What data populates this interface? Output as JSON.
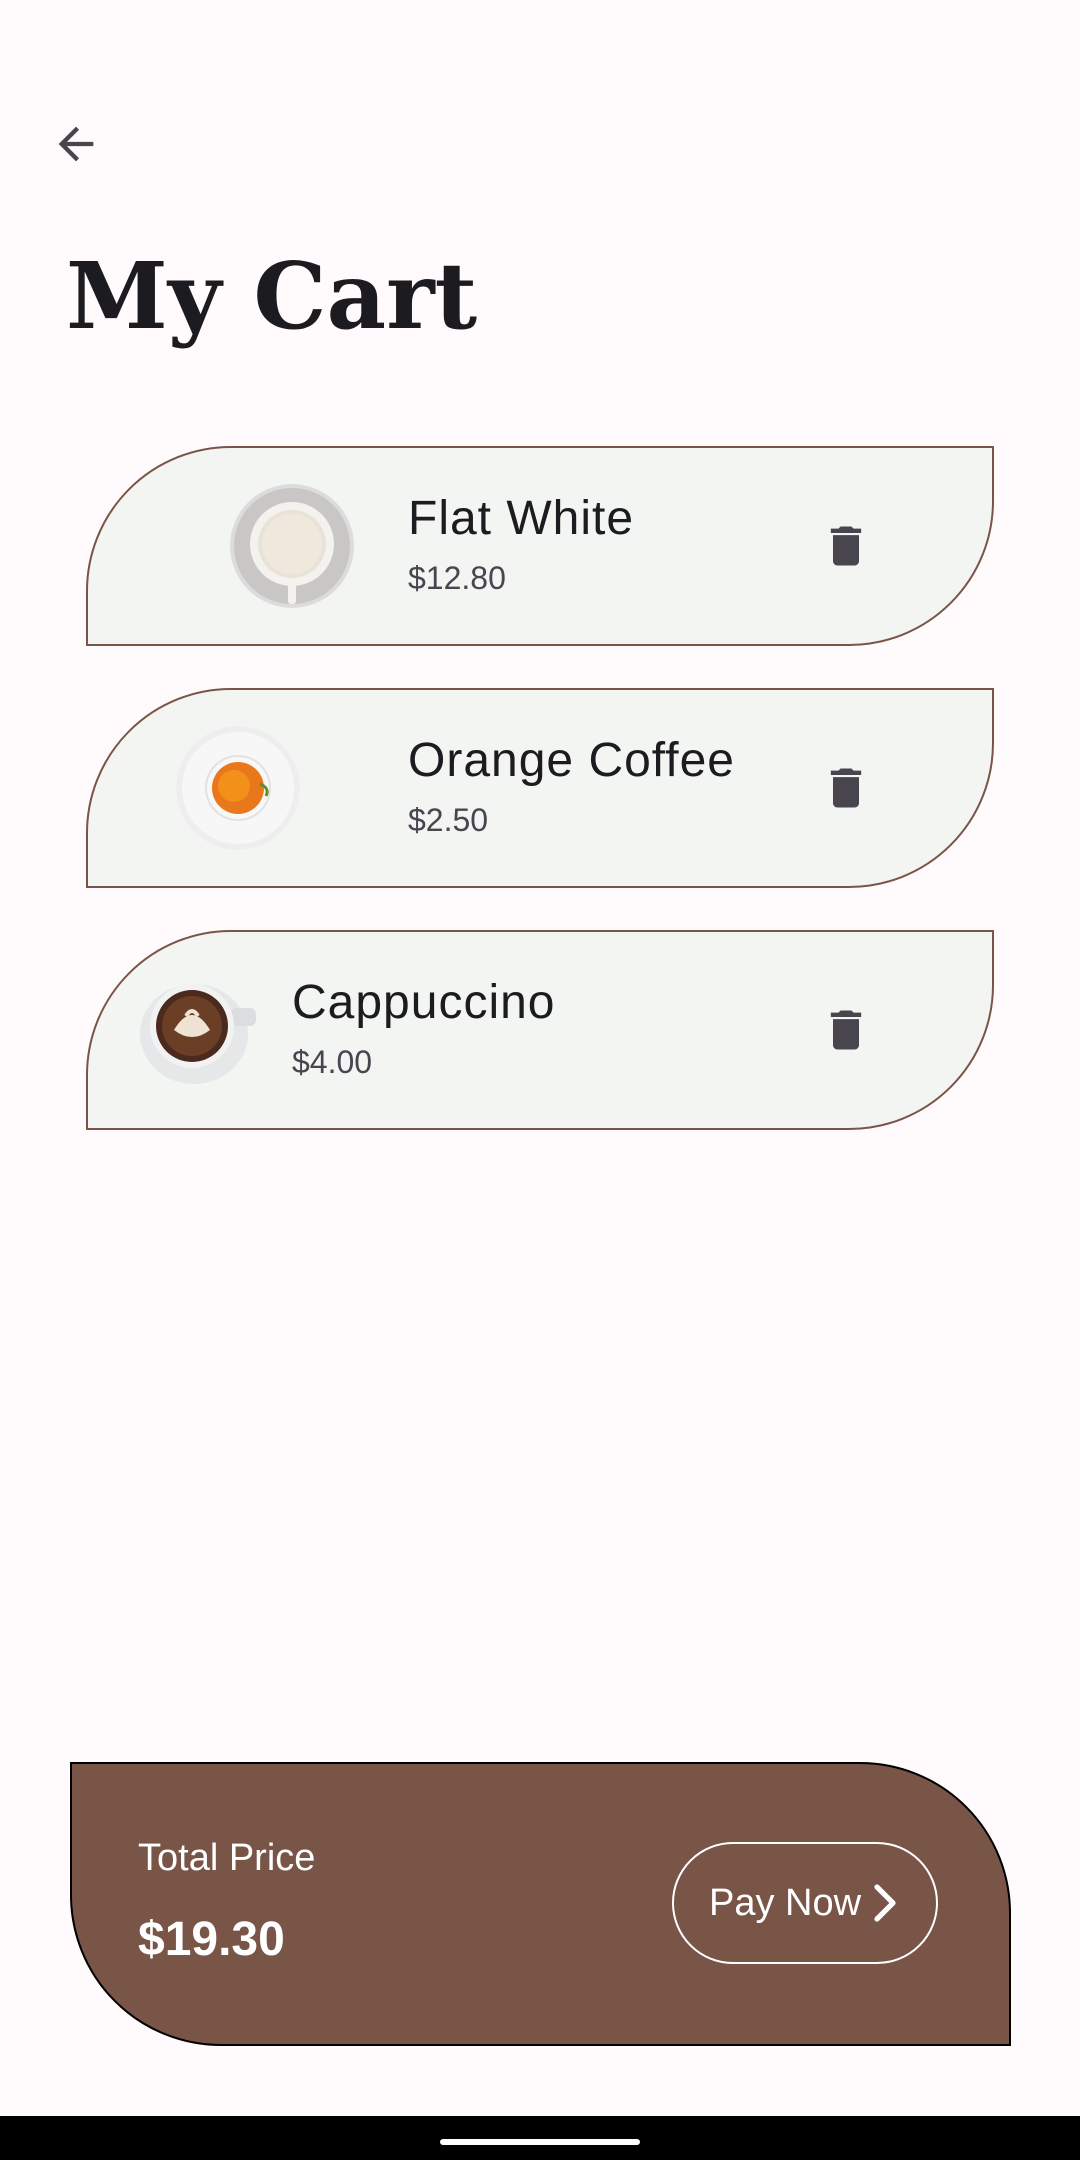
{
  "header": {
    "back_icon": "arrow-back-icon",
    "title": "My Cart"
  },
  "cart": {
    "items": [
      {
        "name": "Flat White",
        "price": "$12.80",
        "image": "flat-white-cup-image",
        "delete_icon": "trash-icon"
      },
      {
        "name": "Orange Coffee",
        "price": "$2.50",
        "image": "orange-coffee-cup-image",
        "delete_icon": "trash-icon"
      },
      {
        "name": "Cappuccino",
        "price": "$4.00",
        "image": "cappuccino-cup-image",
        "delete_icon": "trash-icon"
      }
    ]
  },
  "summary": {
    "total_label": "Total Price",
    "total_value": "$19.30",
    "pay_label": "Pay Now",
    "pay_icon": "chevron-right-icon"
  },
  "colors": {
    "background": "#fffbfc",
    "card_fill": "#f3f5f3",
    "card_border": "#7b5448",
    "panel_fill": "#795548",
    "icon": "#49454f"
  }
}
